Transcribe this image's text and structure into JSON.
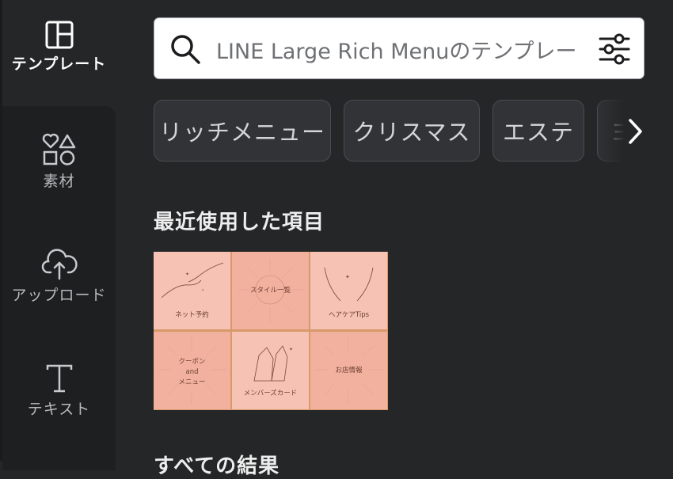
{
  "sidebar": {
    "items": [
      {
        "label": "テンプレート",
        "icon": "template-layout-icon",
        "active": true
      },
      {
        "label": "素材",
        "icon": "elements-shapes-icon",
        "active": false
      },
      {
        "label": "アップロード",
        "icon": "upload-cloud-icon",
        "active": false
      },
      {
        "label": "テキスト",
        "icon": "text-t-icon",
        "active": false
      }
    ]
  },
  "search": {
    "value": "LINE Large Rich Menuのテンプレー",
    "icons": [
      "search-icon",
      "filter-sliders-icon"
    ]
  },
  "chips": [
    "リッチメニュー",
    "クリスマス",
    "エステ",
    "ヨテ"
  ],
  "recent": {
    "title": "最近使用した項目",
    "template_cells": [
      "ネット予約",
      "スタイル一覧",
      "ヘアケアTips",
      "クーポン",
      "and",
      "メニュー",
      "メンバーズカード",
      "お店情報"
    ]
  },
  "all_results": {
    "title": "すべての結果"
  },
  "colors": {
    "background": "#252627",
    "panel": "#1e1f20",
    "chip": "#323336",
    "thumb_pink": "#f6c2b3",
    "thumb_border": "#d89a6a"
  }
}
